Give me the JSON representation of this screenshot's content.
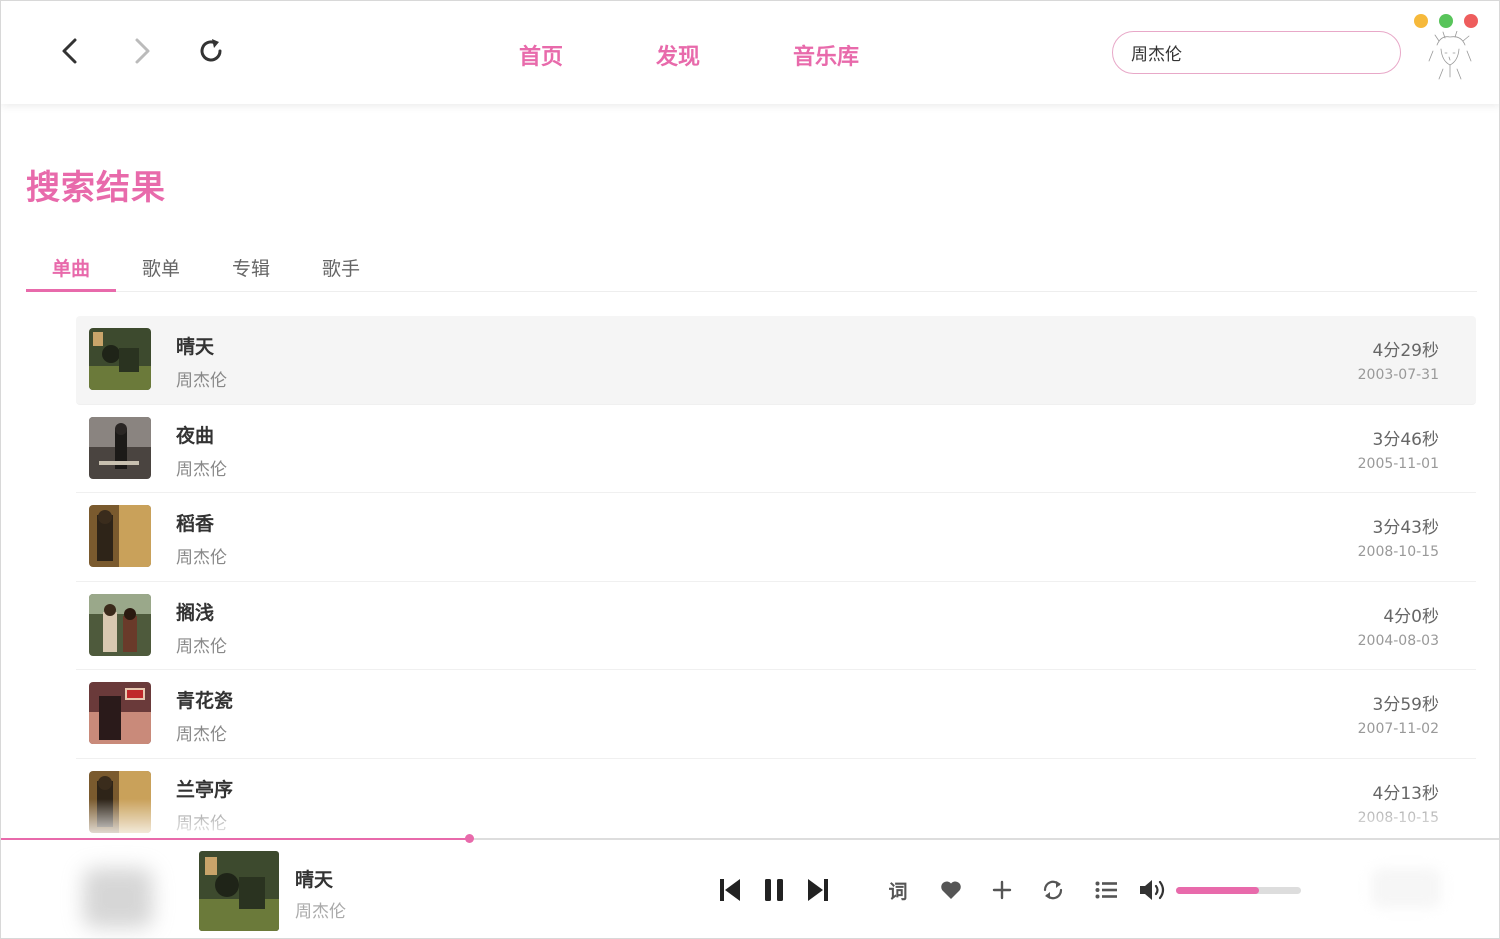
{
  "nav": {
    "links": [
      "首页",
      "发现",
      "音乐库"
    ],
    "search_value": "周杰伦"
  },
  "colors": {
    "accent": "#e86aab",
    "traffic_yellow": "#f6b93b",
    "traffic_green": "#58c45a",
    "traffic_red": "#ee5d5d"
  },
  "page": {
    "title": "搜索结果",
    "tabs": [
      "单曲",
      "歌单",
      "专辑",
      "歌手"
    ],
    "active_tab": "单曲"
  },
  "songs": [
    {
      "name": "晴天",
      "artist": "周杰伦",
      "duration": "4分29秒",
      "date": "2003-07-31"
    },
    {
      "name": "夜曲",
      "artist": "周杰伦",
      "duration": "3分46秒",
      "date": "2005-11-01"
    },
    {
      "name": "稻香",
      "artist": "周杰伦",
      "duration": "3分43秒",
      "date": "2008-10-15"
    },
    {
      "name": "搁浅",
      "artist": "周杰伦",
      "duration": "4分0秒",
      "date": "2004-08-03"
    },
    {
      "name": "青花瓷",
      "artist": "周杰伦",
      "duration": "3分59秒",
      "date": "2007-11-02"
    },
    {
      "name": "兰亭序",
      "artist": "周杰伦",
      "duration": "4分13秒",
      "date": "2008-10-15"
    }
  ],
  "player": {
    "title": "晴天",
    "artist": "周杰伦",
    "lyric_label": "词",
    "progress": 0.312,
    "volume": 0.66
  }
}
